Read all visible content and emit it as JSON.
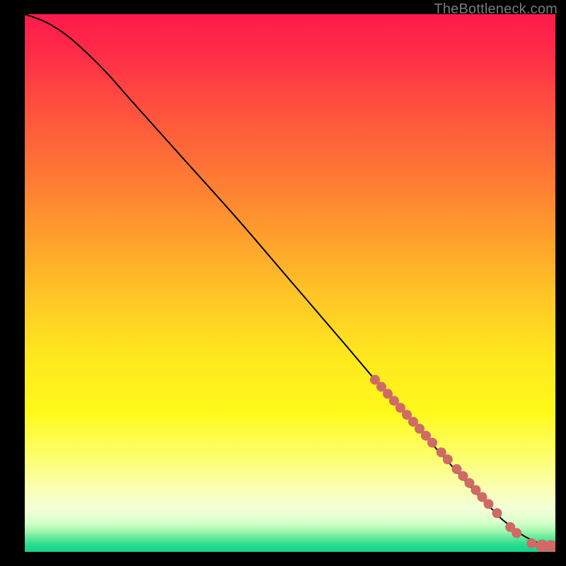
{
  "watermark": "TheBottleneck.com",
  "chart_data": {
    "type": "line",
    "title": "",
    "xlabel": "",
    "ylabel": "",
    "xlim": [
      0,
      100
    ],
    "ylim": [
      0,
      100
    ],
    "grid": false,
    "legend": false,
    "series": [
      {
        "name": "curve",
        "color": "#000000",
        "x": [
          0,
          4,
          8,
          12,
          16,
          20,
          30,
          40,
          50,
          60,
          66,
          70,
          75,
          80,
          85,
          88,
          90,
          92,
          94,
          96,
          98,
          100
        ],
        "y": [
          100,
          98.5,
          96,
          92.5,
          88.5,
          84,
          73,
          62,
          50.5,
          39,
          32,
          27.5,
          22,
          16.5,
          11,
          8,
          6,
          4.5,
          3,
          2,
          1.2,
          1
        ]
      }
    ],
    "markers": {
      "name": "dots",
      "color": "#cf6a66",
      "radius_small": 7,
      "radius_large": 9,
      "x": [
        66,
        67.2,
        68.4,
        69.6,
        70.8,
        72.0,
        73.2,
        74.4,
        75.6,
        76.8,
        78.5,
        79.7,
        81.4,
        82.6,
        83.8,
        85.0,
        86.2,
        87.4,
        89.0,
        91.5,
        92.7,
        95.5,
        97.5,
        99.2
      ],
      "y": [
        32.0,
        30.7,
        29.4,
        28.1,
        26.8,
        25.5,
        24.2,
        22.9,
        21.6,
        20.3,
        18.5,
        17.2,
        15.4,
        14.1,
        12.8,
        11.5,
        10.2,
        8.9,
        7.2,
        4.6,
        3.5,
        1.6,
        1.1,
        1.0
      ],
      "large_idx": [
        22,
        23
      ]
    },
    "gradient_stops": [
      {
        "offset": 0.0,
        "color": "#ff1a4b"
      },
      {
        "offset": 0.07,
        "color": "#ff2b48"
      },
      {
        "offset": 0.17,
        "color": "#ff4f3f"
      },
      {
        "offset": 0.28,
        "color": "#ff7236"
      },
      {
        "offset": 0.4,
        "color": "#ff9a2e"
      },
      {
        "offset": 0.52,
        "color": "#ffc427"
      },
      {
        "offset": 0.63,
        "color": "#ffe61f"
      },
      {
        "offset": 0.74,
        "color": "#fff91a"
      },
      {
        "offset": 0.82,
        "color": "#fdff6a"
      },
      {
        "offset": 0.88,
        "color": "#faffb0"
      },
      {
        "offset": 0.92,
        "color": "#f3ffd8"
      },
      {
        "offset": 0.945,
        "color": "#d8ffca"
      },
      {
        "offset": 0.96,
        "color": "#a8f8b0"
      },
      {
        "offset": 0.975,
        "color": "#5de89a"
      },
      {
        "offset": 0.99,
        "color": "#1fd98c"
      },
      {
        "offset": 1.0,
        "color": "#17d48a"
      }
    ]
  }
}
